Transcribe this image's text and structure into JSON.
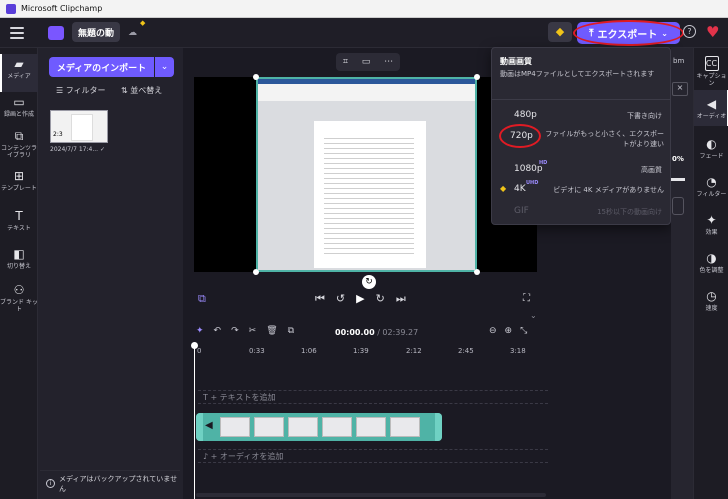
{
  "window": {
    "title": "Microsoft Clipchamp"
  },
  "topbar": {
    "project_name": "無題の動",
    "export_label": "エクスポート"
  },
  "left_rail": {
    "items": [
      {
        "label": "メディア",
        "icon": "folder-icon"
      },
      {
        "label": "録画と作成",
        "icon": "camera-icon"
      },
      {
        "label": "コンテンツライブラリ",
        "icon": "library-icon"
      },
      {
        "label": "テンプレート",
        "icon": "template-icon"
      },
      {
        "label": "テキスト",
        "icon": "text-icon"
      },
      {
        "label": "切り替え",
        "icon": "transition-icon"
      },
      {
        "label": "ブランド キット",
        "icon": "brand-kit-icon"
      }
    ]
  },
  "media": {
    "import_label": "メディアのインポート",
    "filter_label": "フィルター",
    "sort_label": "並べ替え",
    "item_date": "2024/7/7 17:4...",
    "item_duration": "2:3",
    "backup_notice": "メディアはバックアップされていません"
  },
  "export_menu": {
    "header_title": "動画画質",
    "header_desc": "動画はMP4ファイルとしてエクスポートされます",
    "options": [
      {
        "res": "480p",
        "badge": "",
        "desc": "下書き向け"
      },
      {
        "res": "720p",
        "badge": "",
        "desc": "ファイルがもっと小さく、エクスポートがより速い"
      },
      {
        "res": "1080p",
        "badge": "HD",
        "desc": "高画質"
      },
      {
        "res": "4K",
        "badge": "UHD",
        "desc": "ビデオに 4K メディアがありません"
      },
      {
        "res": "GIF",
        "badge": "",
        "desc": "15秒以下の動画向け"
      }
    ]
  },
  "right_rail": {
    "items": [
      {
        "label": "キャプション",
        "icon": "cc-icon"
      },
      {
        "label": "オーディオ",
        "icon": "speaker-icon"
      },
      {
        "label": "フェード",
        "icon": "fade-icon"
      },
      {
        "label": "フィルター",
        "icon": "filter-icon"
      },
      {
        "label": "効果",
        "icon": "wand-icon"
      },
      {
        "label": "色を調整",
        "icon": "contrast-icon"
      },
      {
        "label": "速度",
        "icon": "speed-icon"
      }
    ]
  },
  "right_panel": {
    "fragment_text": "bm",
    "percent": "0%"
  },
  "timeline": {
    "time_current": "00:00.00",
    "time_total": "/ 02:39.27",
    "ticks": [
      "0",
      "0:33",
      "1:06",
      "1:39",
      "2:12",
      "2:45",
      "3:18"
    ],
    "text_track": "+ テキストを追加",
    "audio_track": "+ オーディオを追加"
  }
}
